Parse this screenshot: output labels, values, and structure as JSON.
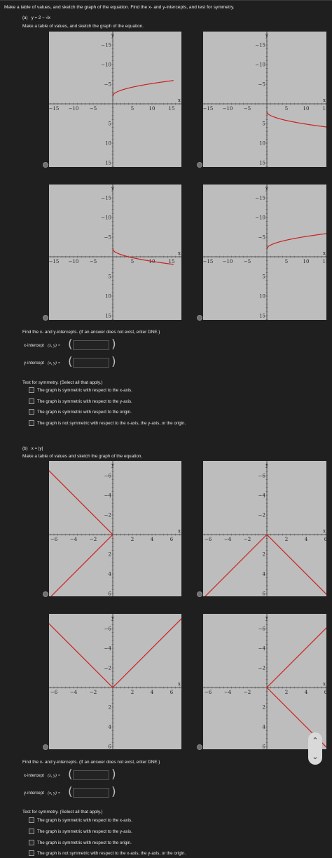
{
  "instruction": "Make a table of values, and sketch the graph of the equation. Find the x- and y-intercepts, and test for symmetry.",
  "part_a": {
    "label": "(a)",
    "equation": "y = 2 − √x",
    "sketch_prompt": "Make a table of values, and sketch the graph of the equation.",
    "graph_options": [
      {
        "name": "option-1",
        "curve": "y = 2 + sqrt(x)"
      },
      {
        "name": "option-2",
        "curve": "y = -2 - sqrt(x)"
      },
      {
        "name": "option-3",
        "curve": "y = 2 - sqrt(x)"
      },
      {
        "name": "option-4",
        "curve": "y = 2 + sqrt(x)"
      }
    ],
    "axis_ticks": [
      "−15",
      "−10",
      "−5",
      "5",
      "10",
      "15"
    ],
    "y_ticks": [
      "15",
      "10",
      "5",
      "−5",
      "−10",
      "−15"
    ],
    "intercepts_prompt": "Find the x- and y-intercepts. (If an answer does not exist, enter DNE.)",
    "x_intercept_label": "x-intercept",
    "y_intercept_label": "y-intercept",
    "xy_label": "(x, y) =",
    "x_intercept_value": "",
    "y_intercept_value": "",
    "symmetry_prompt": "Test for symmetry. (Select all that apply.)",
    "symmetry_options": [
      "The graph is symmetric with respect to the x-axis.",
      "The graph is symmetric with respect to the y-axis.",
      "The graph is symmetric with respect to the origin.",
      "The graph is not symmetric with respect to the x-axis, the y-axis, or the origin."
    ]
  },
  "part_b": {
    "label": "(b)",
    "equation": "x = |y|",
    "sketch_prompt": "Make a table of values and sketch the graph of the equation.",
    "graph_options": [
      {
        "name": "option-1",
        "curve": "x = -|y|"
      },
      {
        "name": "option-2",
        "curve": "y = -|x|"
      },
      {
        "name": "option-3",
        "curve": "y = |x|"
      },
      {
        "name": "option-4",
        "curve": "x = |y|"
      }
    ],
    "axis_ticks": [
      "−6",
      "−4",
      "−2",
      "2",
      "4",
      "6"
    ],
    "y_ticks": [
      "6",
      "4",
      "2",
      "−2",
      "−4",
      "−6"
    ],
    "intercepts_prompt": "Find the x- and y-intercepts. (If an answer does not exist, enter DNE.)",
    "x_intercept_label": "x-intercept",
    "y_intercept_label": "y-intercept",
    "xy_label": "(x, y) =",
    "x_intercept_value": "",
    "y_intercept_value": "",
    "symmetry_prompt": "Test for symmetry. (Select all that apply.)",
    "symmetry_options": [
      "The graph is symmetric with respect to the x-axis.",
      "The graph is symmetric with respect to the y-axis.",
      "The graph is symmetric with respect to the origin.",
      "The graph is not symmetric with respect to the x-axis, the y-axis, or the origin."
    ]
  },
  "axis_labels": {
    "x": "x",
    "y": "y"
  },
  "colors": {
    "curve": "#cc1f1f",
    "graph_bg": "#bdbdbd",
    "page_bg": "#1f1f1f"
  },
  "nav": {
    "up_icon": "chevron-up-icon",
    "down_icon": "chevron-down-icon"
  }
}
